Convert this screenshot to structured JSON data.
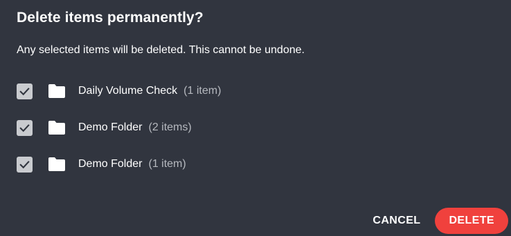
{
  "dialog": {
    "title": "Delete items permanently?",
    "message": "Any selected items will be deleted. This cannot be undone.",
    "items": [
      {
        "name": "Daily Volume Check",
        "count": "(1 item)",
        "checked": true,
        "icon": "folder-icon"
      },
      {
        "name": "Demo Folder",
        "count": "(2 items)",
        "checked": true,
        "icon": "folder-icon"
      },
      {
        "name": "Demo Folder",
        "count": "(1 item)",
        "checked": true,
        "icon": "folder-icon"
      }
    ],
    "actions": {
      "cancel_label": "CANCEL",
      "delete_label": "DELETE"
    }
  },
  "colors": {
    "background": "#31353f",
    "text": "#ffffff",
    "muted_text": "#b6b9bf",
    "checkbox": "#c9cbcf",
    "danger": "#f0413d"
  }
}
